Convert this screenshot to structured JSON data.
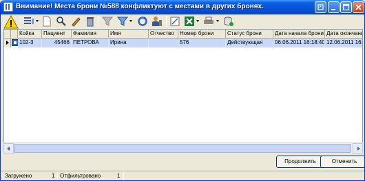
{
  "window": {
    "title": "Внимание! Места брони №588 конфликтуют с местами в других бронях."
  },
  "toolbar": {
    "icons": [
      "warning-icon",
      "view-options-icon",
      "new-document-icon",
      "find-icon",
      "edit-icon",
      "delete-icon",
      "filter-clear-icon",
      "filter-icon",
      "refresh-icon",
      "guest-icon",
      "export-icon",
      "excel-icon",
      "print-icon",
      "database-icon"
    ]
  },
  "grid": {
    "columns": [
      "Койка",
      "Пациент",
      "Фамилия",
      "Имя",
      "Отчество",
      "Номер брони",
      "Статус брони",
      "Дата начала брони",
      "Дата окончани"
    ],
    "rows": [
      {
        "cells": [
          "102-3",
          "45466",
          "ПЕТРОВА",
          "Ирина",
          "",
          "576",
          "Действующая",
          "06.06.2011 16:18:40",
          "12.06.2011 16:1"
        ]
      }
    ]
  },
  "buttons": {
    "continue_label": "Продолжить",
    "cancel_label": "Отменить"
  },
  "status": {
    "loaded_label": "Загружено",
    "loaded_count": "1",
    "filtered_label": "Отфильтровано",
    "filtered_count": "1"
  },
  "colors": {
    "title_bar": "#0754D8",
    "selected_row": "#C9D8F5",
    "face": "#ECE9D8"
  }
}
